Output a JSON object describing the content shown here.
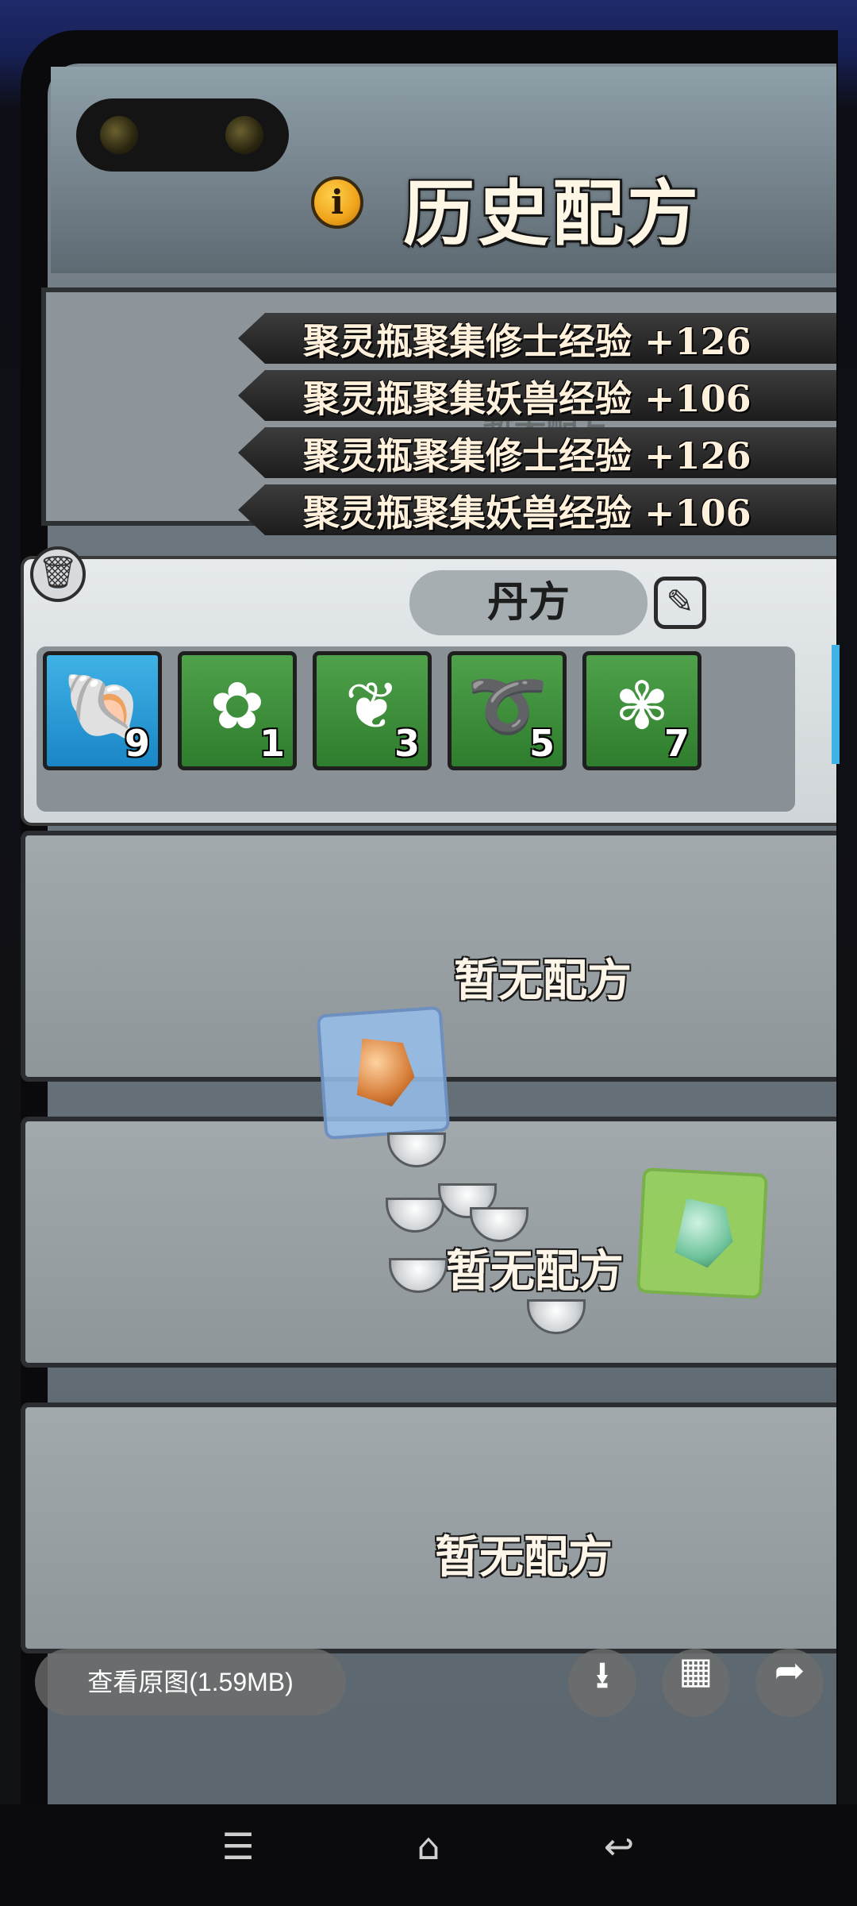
{
  "header": {
    "title": "历史配方",
    "info_icon": "info-icon"
  },
  "history": {
    "ghost_text": "暂无配方",
    "entries": [
      {
        "text": "聚灵瓶聚集修士经验 +126"
      },
      {
        "text": "聚灵瓶聚集妖兽经验 +106"
      },
      {
        "text": "聚灵瓶聚集修士经验 +126"
      },
      {
        "text": "聚灵瓶聚集妖兽经验 +106"
      }
    ]
  },
  "recipe": {
    "tab_label": "丹方",
    "trash_icon": "trash-icon",
    "edit_icon": "edit-icon",
    "ingredients": [
      {
        "icon": "shell-icon",
        "count": "9",
        "background": "#2a9bd6"
      },
      {
        "icon": "flower-pink-icon",
        "count": "1",
        "background": "#3d8f3a"
      },
      {
        "icon": "root-icon",
        "count": "3",
        "background": "#3d8f3a"
      },
      {
        "icon": "vine-icon",
        "count": "5",
        "background": "#3d8f3a"
      },
      {
        "icon": "flower-red-icon",
        "count": "7",
        "background": "#3d8f3a"
      }
    ]
  },
  "cards": [
    {
      "text": "暂无配方"
    },
    {
      "text": "暂无配方"
    },
    {
      "text": "暂无配方"
    }
  ],
  "viewer": {
    "view_original_label": "查看原图(1.59MB)",
    "download_icon": "download-icon",
    "grid_icon": "grid-icon",
    "share_icon": "share-icon"
  },
  "system_nav": {
    "menu_icon": "menu-icon",
    "home_icon": "home-icon",
    "back_icon": "back-icon"
  }
}
